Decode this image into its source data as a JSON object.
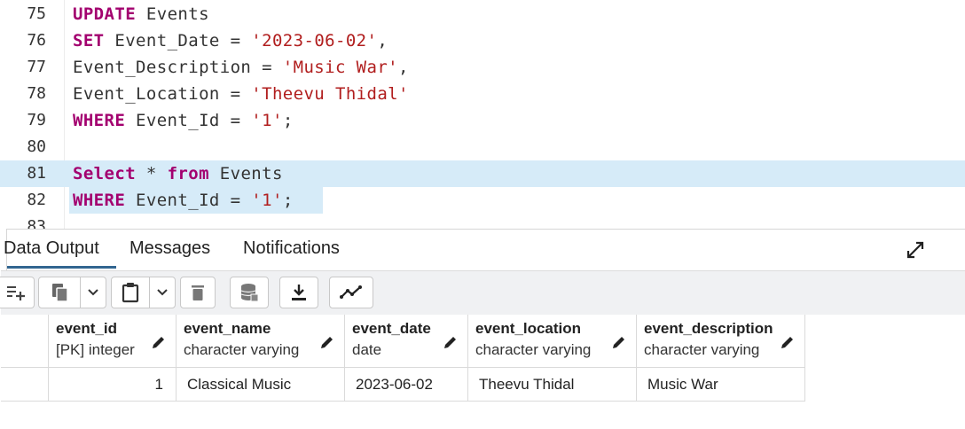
{
  "editor": {
    "lines": [
      {
        "num": "75",
        "tokens": [
          {
            "t": "UPDATE",
            "c": "kw"
          },
          {
            "t": " Events",
            "c": ""
          }
        ]
      },
      {
        "num": "76",
        "tokens": [
          {
            "t": "SET",
            "c": "kw"
          },
          {
            "t": " Event_Date = ",
            "c": ""
          },
          {
            "t": "'2023-06-02'",
            "c": "str"
          },
          {
            "t": ",",
            "c": ""
          }
        ]
      },
      {
        "num": "77",
        "tokens": [
          {
            "t": "Event_Description = ",
            "c": ""
          },
          {
            "t": "'Music War'",
            "c": "str"
          },
          {
            "t": ",",
            "c": ""
          }
        ]
      },
      {
        "num": "78",
        "tokens": [
          {
            "t": "Event_Location = ",
            "c": ""
          },
          {
            "t": "'Theevu Thidal'",
            "c": "str"
          }
        ]
      },
      {
        "num": "79",
        "tokens": [
          {
            "t": "WHERE",
            "c": "kw"
          },
          {
            "t": " Event_Id = ",
            "c": ""
          },
          {
            "t": "'1'",
            "c": "str"
          },
          {
            "t": ";",
            "c": ""
          }
        ]
      },
      {
        "num": "80",
        "tokens": []
      },
      {
        "num": "81",
        "tokens": [
          {
            "t": "Select",
            "c": "kw"
          },
          {
            "t": " * ",
            "c": ""
          },
          {
            "t": "from",
            "c": "kw"
          },
          {
            "t": " Events",
            "c": ""
          }
        ]
      },
      {
        "num": "82",
        "tokens": [
          {
            "t": "WHERE",
            "c": "kw"
          },
          {
            "t": " Event_Id = ",
            "c": ""
          },
          {
            "t": "'1'",
            "c": "str"
          },
          {
            "t": ";",
            "c": ""
          }
        ]
      },
      {
        "num": "83",
        "tokens": []
      }
    ]
  },
  "output": {
    "tabs": [
      {
        "label": "Data Output",
        "active": true
      },
      {
        "label": "Messages",
        "active": false
      },
      {
        "label": "Notifications",
        "active": false
      }
    ],
    "toolbar": [
      {
        "icon": "add-row-icon"
      },
      {
        "icon": "copy-icon"
      },
      {
        "icon": "chevron-down-icon"
      },
      {
        "icon": "paste-icon"
      },
      {
        "icon": "chevron-down-icon"
      },
      {
        "icon": "delete-icon"
      },
      {
        "icon": "save-data-icon"
      },
      {
        "icon": "download-icon"
      },
      {
        "icon": "graph-icon"
      }
    ],
    "columns": [
      {
        "name": "event_id",
        "type": "[PK] integer"
      },
      {
        "name": "event_name",
        "type": "character varying"
      },
      {
        "name": "event_date",
        "type": "date"
      },
      {
        "name": "event_location",
        "type": "character varying"
      },
      {
        "name": "event_description",
        "type": "character varying"
      }
    ],
    "rows": [
      [
        "1",
        "Classical Music",
        "2023-06-02",
        "Theevu Thidal",
        "Music War"
      ]
    ]
  },
  "colors": {
    "keyword": "#a3006f",
    "string": "#b11e1e",
    "selection": "#d6ebf8",
    "active_tab": "#326690"
  }
}
